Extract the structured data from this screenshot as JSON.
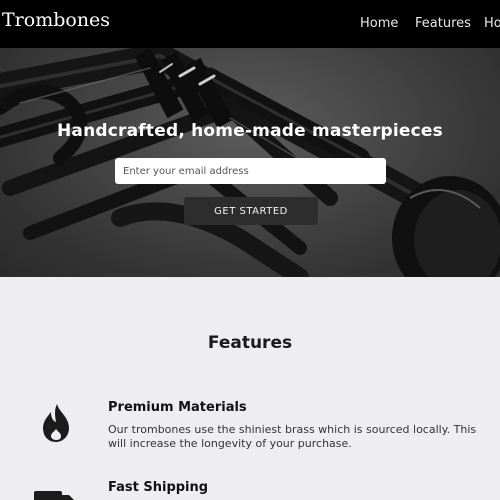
{
  "nav": {
    "brand": "Trombones",
    "links": [
      "Home",
      "Features",
      "Ho"
    ]
  },
  "hero": {
    "title": "Handcrafted, home-made masterpieces",
    "email_placeholder": "Enter your email address",
    "cta_label": "GET STARTED"
  },
  "features": {
    "title": "Features",
    "items": [
      {
        "icon": "fire-icon",
        "heading": "Premium Materials",
        "text": "Our trombones use the shiniest brass which is sourced locally. This will increase the longevity of your purchase."
      },
      {
        "icon": "truck-icon",
        "heading": "Fast Shipping",
        "text": ""
      }
    ]
  },
  "colors": {
    "navbar": "#000000",
    "hero_overlay": "#464646",
    "button": "#2d2d2d",
    "page_background": "#eeeef0"
  }
}
